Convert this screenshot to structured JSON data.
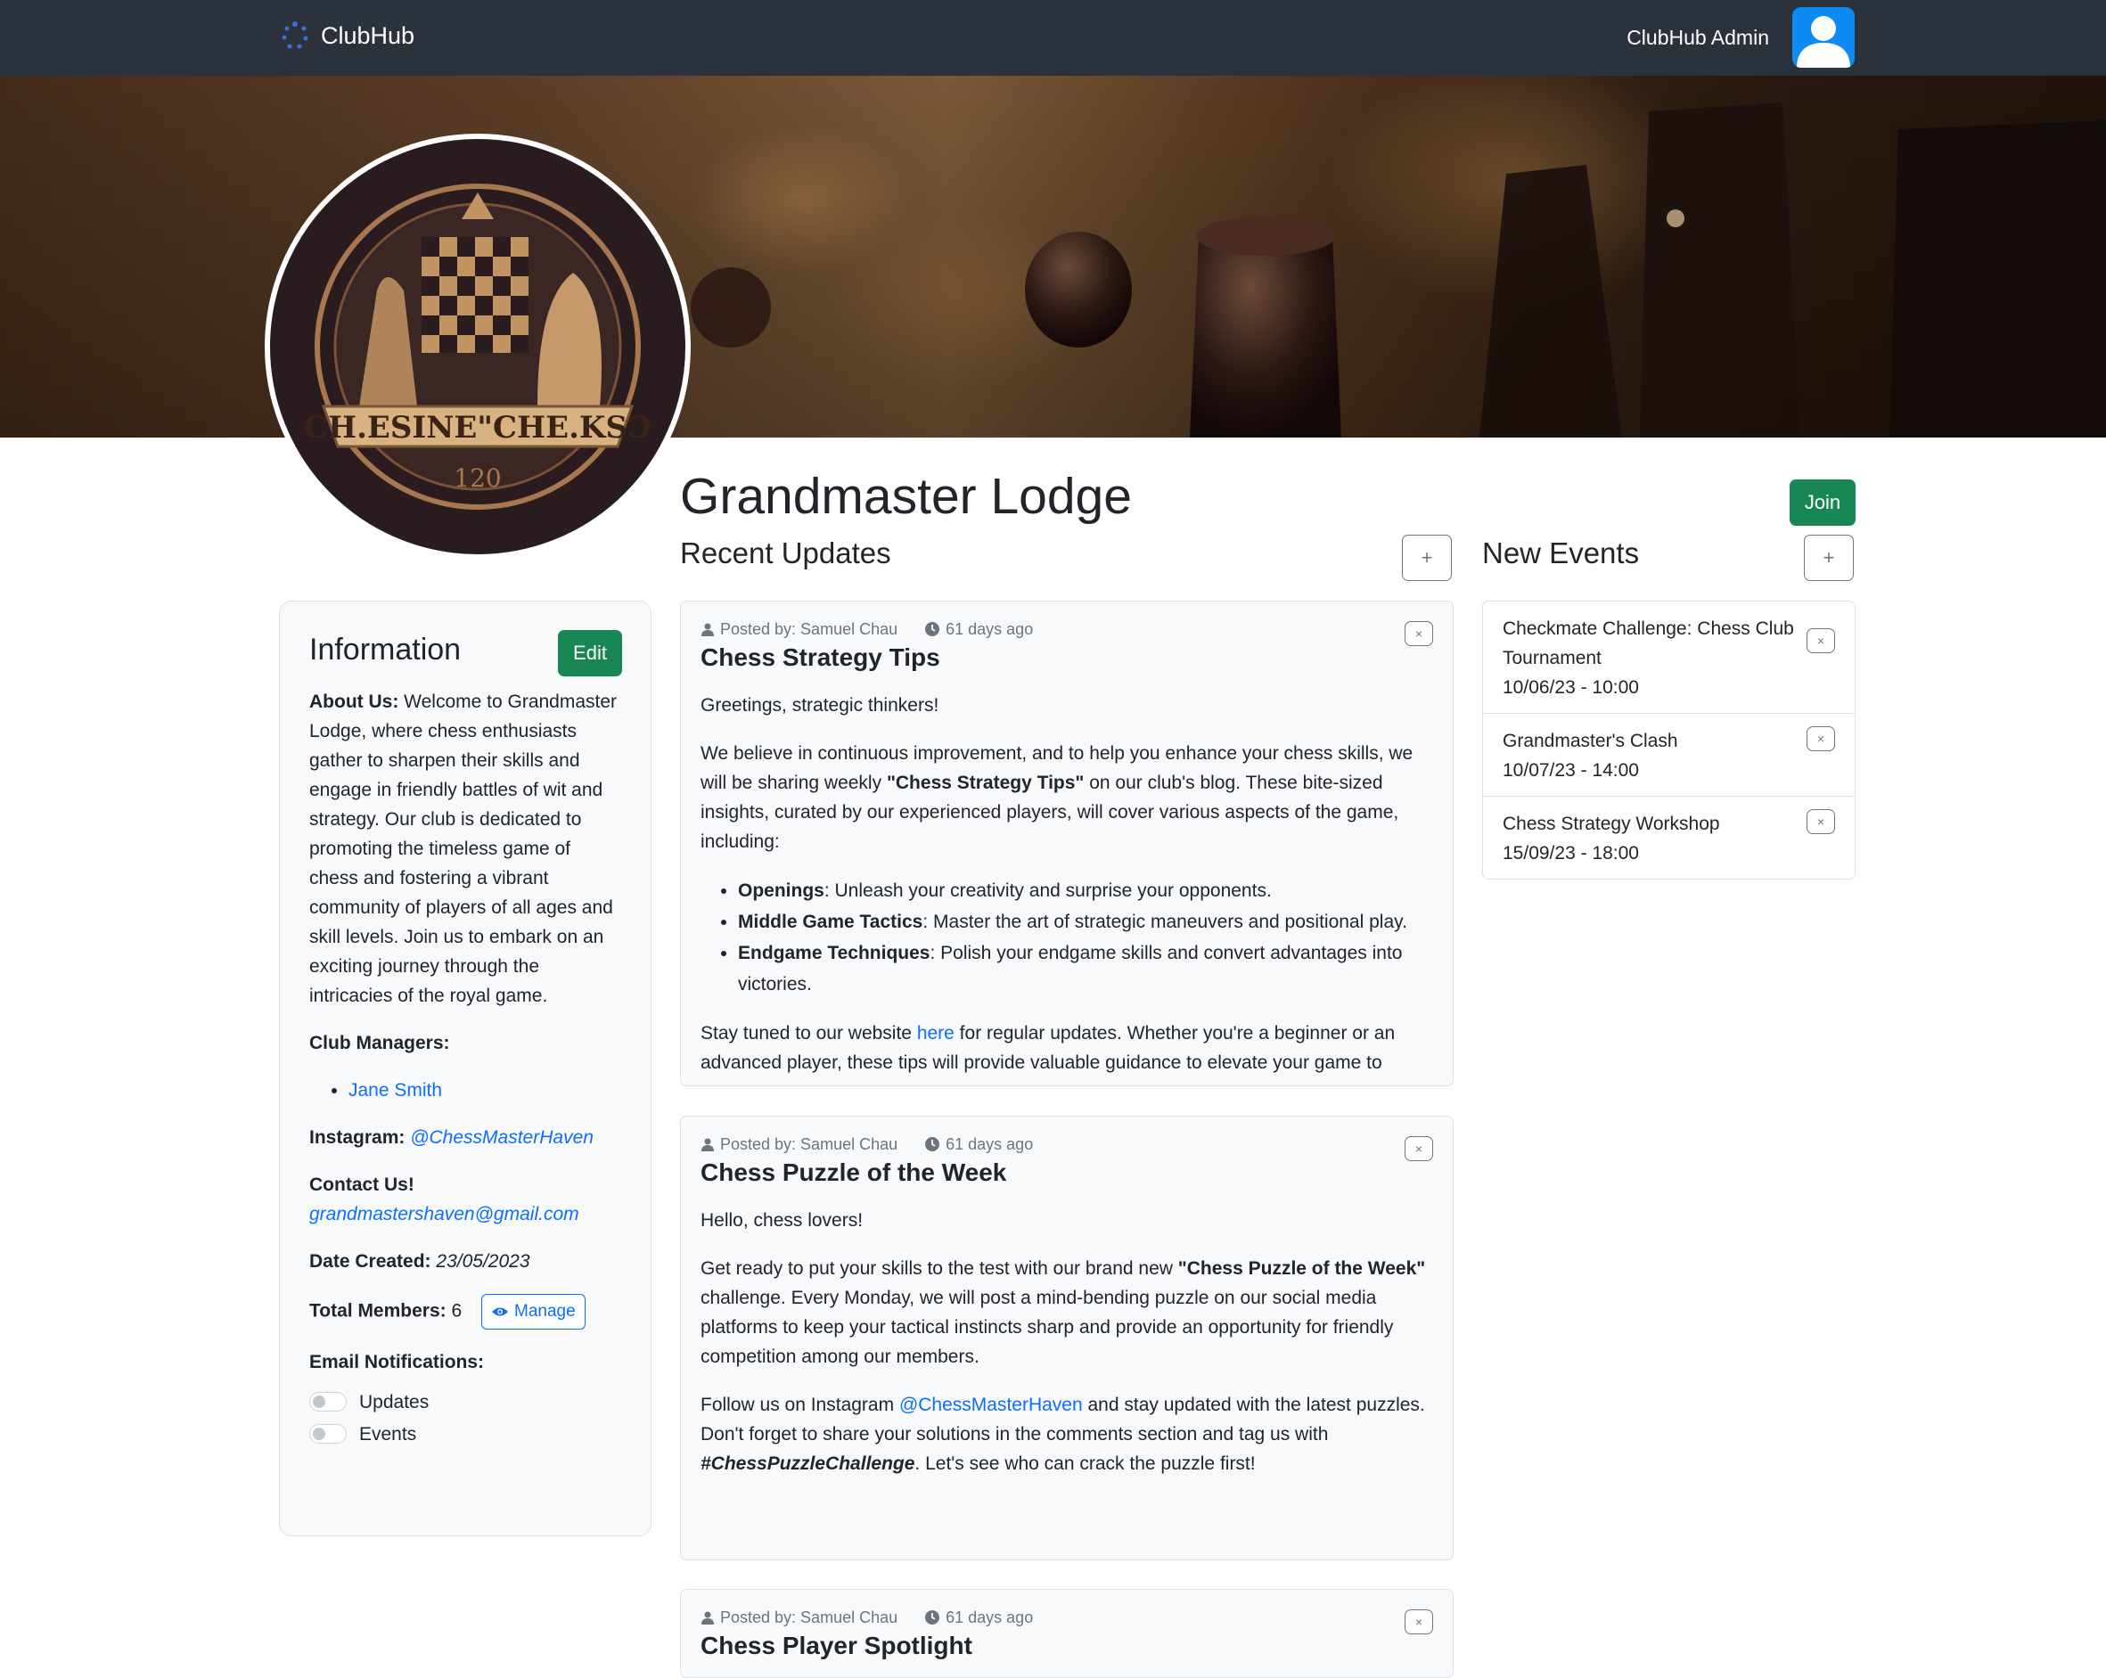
{
  "nav": {
    "brand": "ClubHub",
    "user": "ClubHub Admin"
  },
  "club": {
    "name": "Grandmaster Lodge",
    "join_label": "Join",
    "logo_text": "CH.ESINE\"CHE.KSƆ",
    "logo_year": "120"
  },
  "sections": {
    "updates_title": "Recent Updates",
    "events_title": "New Events",
    "add_label": "+"
  },
  "info": {
    "title": "Information",
    "edit_label": "Edit",
    "about_label": "About Us:",
    "about_text": "Welcome to Grandmaster Lodge, where chess enthusiasts gather to sharpen their skills and engage in friendly battles of wit and strategy. Our club is dedicated to promoting the timeless game of chess and fostering a vibrant community of players of all ages and skill levels. Join us to embark on an exciting journey through the intricacies of the royal game.",
    "managers_label": "Club Managers:",
    "managers": [
      "Jane Smith"
    ],
    "instagram_label": "Instagram:",
    "instagram": "@ChessMasterHaven",
    "contact_label": "Contact Us!",
    "email": "grandmastershaven@gmail.com",
    "date_label": "Date Created:",
    "date": "23/05/2023",
    "members_label": "Total Members:",
    "members": "6",
    "manage_label": "Manage",
    "notifications_label": "Email Notifications:",
    "toggles": [
      "Updates",
      "Events"
    ]
  },
  "updates": [
    {
      "posted_by": "Posted by: Samuel Chau",
      "time": "61 days ago",
      "title": "Chess Strategy Tips",
      "greeting": "Greetings, strategic thinkers!",
      "p1_a": "We believe in continuous improvement, and to help you enhance your chess skills, we will be sharing weekly ",
      "p1_b": "\"Chess Strategy Tips\"",
      "p1_c": " on our club's blog. These bite-sized insights, curated by our experienced players, will cover various aspects of the game, including:",
      "bullets": [
        {
          "b": "Openings",
          "t": ": Unleash your creativity and surprise your opponents."
        },
        {
          "b": "Middle Game Tactics",
          "t": ": Master the art of strategic maneuvers and positional play."
        },
        {
          "b": "Endgame Techniques",
          "t": ": Polish your endgame skills and convert advantages into victories."
        }
      ],
      "p2_a": "Stay tuned to our website ",
      "p2_link": "here",
      "p2_b": " for regular updates. Whether you're a beginner or an advanced player, these tips will provide valuable guidance to elevate your game to"
    },
    {
      "posted_by": "Posted by: Samuel Chau",
      "time": "61 days ago",
      "title": "Chess Puzzle of the Week",
      "greeting": "Hello, chess lovers!",
      "p1_a": "Get ready to put your skills to the test with our brand new ",
      "p1_b": "\"Chess Puzzle of the Week\"",
      "p1_c": " challenge. Every Monday, we will post a mind-bending puzzle on our social media platforms to keep your tactical instincts sharp and provide an opportunity for friendly competition among our members.",
      "p2_a": "Follow us on Instagram ",
      "p2_link": "@ChessMasterHaven",
      "p2_b": " and stay updated with the latest puzzles. Don't forget to share your solutions in the comments section and tag us with ",
      "p2_hashtag": "#ChessPuzzleChallenge",
      "p2_c": ". Let's see who can crack the puzzle first!"
    },
    {
      "posted_by": "Posted by: Samuel Chau",
      "time": "61 days ago",
      "title": "Chess Player Spotlight"
    }
  ],
  "events": [
    {
      "title": "Checkmate Challenge: Chess Club Tournament",
      "when": "10/06/23 - 10:00"
    },
    {
      "title": "Grandmaster's Clash",
      "when": "10/07/23 - 14:00"
    },
    {
      "title": "Chess Strategy Workshop",
      "when": "15/09/23 - 18:00"
    }
  ],
  "icons": {
    "close": "×",
    "brand": "dots-spinner-icon",
    "person": "person-icon",
    "clock": "clock-icon",
    "eye": "eye-icon"
  },
  "colors": {
    "navbar": "#2c323b",
    "success": "#198754",
    "primary": "#0d6efd",
    "avatar": "#0d8bf2"
  }
}
